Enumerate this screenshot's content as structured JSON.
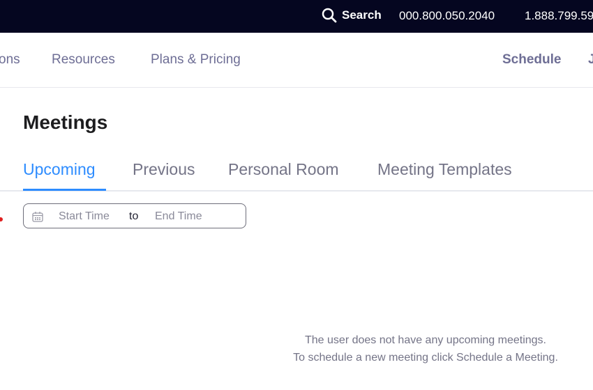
{
  "topbar": {
    "search_label": "Search",
    "phone_1": "000.800.050.2040",
    "phone_2": "1.888.799.59"
  },
  "nav": {
    "items": [
      "ons",
      "Resources",
      "Plans & Pricing"
    ],
    "schedule_label": "Schedule",
    "cut_item": "J"
  },
  "page": {
    "title": "Meetings",
    "tabs": [
      "Upcoming",
      "Previous",
      "Personal Room",
      "Meeting Templates"
    ],
    "active_tab": "Upcoming"
  },
  "date_filter": {
    "start_placeholder": "Start Time",
    "separator": "to",
    "end_placeholder": "End Time"
  },
  "empty_state": {
    "line1": "The user does not have any upcoming meetings.",
    "line2": "To schedule a new meeting click Schedule a Meeting."
  },
  "colors": {
    "topbar_bg": "#050620",
    "accent": "#2d8cff",
    "nav_text": "#6e6e95"
  }
}
